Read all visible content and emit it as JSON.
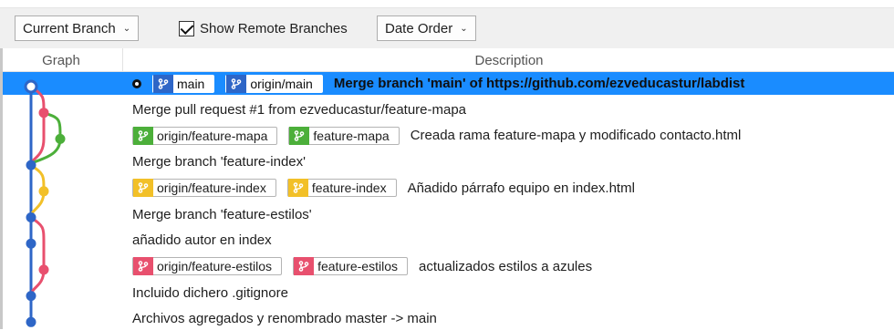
{
  "toolbar": {
    "branch_select": "Current Branch",
    "show_remote_label": "Show Remote Branches",
    "show_remote_checked": true,
    "order_select": "Date Order"
  },
  "columns": {
    "graph": "Graph",
    "description": "Description"
  },
  "colors": {
    "selection": "#1a8cff",
    "blue": "#2e66c7",
    "pink": "#e8506e",
    "green": "#4caf3a",
    "yellow": "#f2c028",
    "tag_border": "#b4b4b4"
  },
  "rows": [
    {
      "tags": [
        {
          "label": "main",
          "color": "#2e66c7",
          "icon": "branch-icon"
        },
        {
          "label": "origin/main",
          "color": "#2e66c7",
          "icon": "branch-icon"
        }
      ],
      "message": "Merge branch 'main' of https://github.com/ezveducastur/labdist",
      "selected": true,
      "head": true
    },
    {
      "tags": [],
      "message": "Merge pull request #1 from ezveducastur/feature-mapa"
    },
    {
      "tags": [
        {
          "label": "origin/feature-mapa",
          "color": "#4caf3a",
          "icon": "branch-icon"
        },
        {
          "label": "feature-mapa",
          "color": "#4caf3a",
          "icon": "branch-icon"
        }
      ],
      "message": "Creada rama feature-mapa y modificado contacto.html"
    },
    {
      "tags": [],
      "message": "Merge branch 'feature-index'"
    },
    {
      "tags": [
        {
          "label": "origin/feature-index",
          "color": "#f2c028",
          "icon": "branch-icon"
        },
        {
          "label": "feature-index",
          "color": "#f2c028",
          "icon": "branch-icon"
        }
      ],
      "message": "Añadido párrafo equipo en index.html"
    },
    {
      "tags": [],
      "message": "Merge branch 'feature-estilos'"
    },
    {
      "tags": [],
      "message": "añadido autor en index"
    },
    {
      "tags": [
        {
          "label": "origin/feature-estilos",
          "color": "#e8506e",
          "icon": "branch-icon"
        },
        {
          "label": "feature-estilos",
          "color": "#e8506e",
          "icon": "branch-icon"
        }
      ],
      "message": "actualizados estilos a azules"
    },
    {
      "tags": [],
      "message": "Incluido dichero .gitignore"
    },
    {
      "tags": [],
      "message": "Archivos agregados y renombrado master -> main"
    }
  ]
}
